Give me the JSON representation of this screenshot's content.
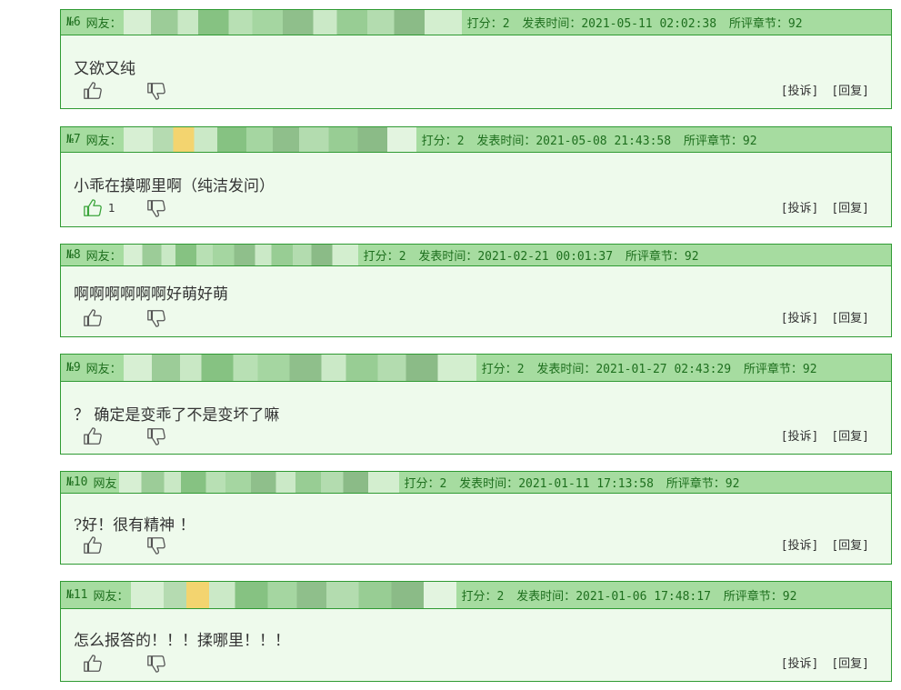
{
  "comments": [
    {
      "floor": "№6",
      "user_label": "网友：",
      "rating_label": "打分：",
      "rating": "2",
      "time_label": "发表时间：",
      "time": "2021-05-11 02:02:38",
      "chapter_label": "所评章节：",
      "chapter": "92",
      "text": "又欲又纯",
      "likes": "",
      "report": "[投诉]",
      "reply": "[回复]"
    },
    {
      "floor": "№7",
      "user_label": "网友：",
      "rating_label": "打分：",
      "rating": "2",
      "time_label": "发表时间：",
      "time": "2021-05-08 21:43:58",
      "chapter_label": "所评章节：",
      "chapter": "92",
      "text": "小乖在摸哪里啊（纯洁发问）",
      "likes": "1",
      "report": "[投诉]",
      "reply": "[回复]"
    },
    {
      "floor": "№8",
      "user_label": "网友：",
      "rating_label": "打分：",
      "rating": "2",
      "time_label": "发表时间：",
      "time": "2021-02-21 00:01:37",
      "chapter_label": "所评章节：",
      "chapter": "92",
      "text": "啊啊啊啊啊啊好萌好萌",
      "likes": "",
      "report": "[投诉]",
      "reply": "[回复]"
    },
    {
      "floor": "№9",
      "user_label": "网友：",
      "rating_label": "打分：",
      "rating": "2",
      "time_label": "发表时间：",
      "time": "2021-01-27 02:43:29",
      "chapter_label": "所评章节：",
      "chapter": "92",
      "text": "？ 确定是变乖了不是变坏了嘛",
      "likes": "",
      "report": "[投诉]",
      "reply": "[回复]"
    },
    {
      "floor": "№10",
      "user_label": "网友",
      "rating_label": "打分：",
      "rating": "2",
      "time_label": "发表时间：",
      "time": "2021-01-11 17:13:58",
      "chapter_label": "所评章节：",
      "chapter": "92",
      "text": "?好！很有精神 ！",
      "likes": "",
      "report": "[投诉]",
      "reply": "[回复]"
    },
    {
      "floor": "№11",
      "user_label": "网友：",
      "rating_label": "打分：",
      "rating": "2",
      "time_label": "发表时间：",
      "time": "2021-01-06 17:48:17",
      "chapter_label": "所评章节：",
      "chapter": "92",
      "text": "怎么报答的！！！揉哪里！！！",
      "likes": "",
      "report": "[投诉]",
      "reply": "[回复]"
    }
  ],
  "colors": {
    "header_bg": "#a6dca0",
    "body_bg": "#eefaec",
    "border": "#2f9a33",
    "header_text": "#1e6f1e",
    "like_active": "#3aa43a",
    "icon": "#555555"
  },
  "icons": {
    "like": "thumbs-up-icon",
    "dislike": "thumbs-down-icon"
  }
}
